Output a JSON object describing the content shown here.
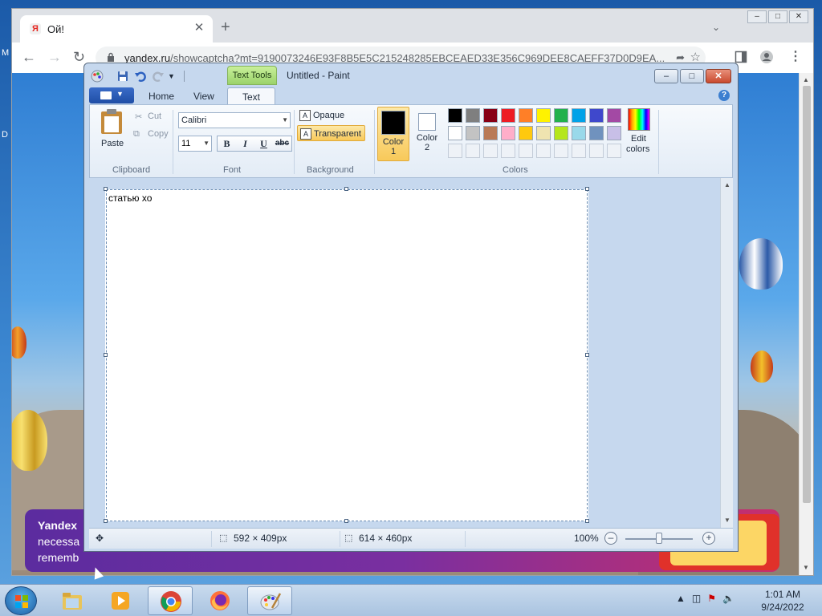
{
  "desktop": {
    "edge_labels": [
      "M",
      "D"
    ]
  },
  "browser": {
    "tab_title": "Ой!",
    "favicon_letter": "Я",
    "tab_close": "✕",
    "new_tab": "+",
    "url_domain": "yandex.ru",
    "url_rest": "/showcaptcha?mt=9190073246E93F8B5E5C215248285EBCEAED33E356C969DEE8CAEFF37D0D9EA...",
    "cookie_title": "Yandex",
    "cookie_line1": "necessa",
    "cookie_line2": "rememb"
  },
  "paint": {
    "context_tab": "Text Tools",
    "title": "Untitled - Paint",
    "tabs": [
      "Home",
      "View",
      "Text"
    ],
    "active_tab": "Text",
    "clipboard": {
      "paste": "Paste",
      "cut": "Cut",
      "copy": "Copy",
      "group": "Clipboard"
    },
    "font": {
      "family": "Calibri",
      "size": "11",
      "group": "Font",
      "bold": "B",
      "italic": "I",
      "underline": "U",
      "strike": "abc"
    },
    "background": {
      "opaque": "Opaque",
      "transparent": "Transparent",
      "group": "Background"
    },
    "colors": {
      "color1_label": "Color",
      "color1_num": "1",
      "color2_label": "Color",
      "color2_num": "2",
      "edit_label": "Edit",
      "edit_label2": "colors",
      "group": "Colors",
      "color1": "#000000",
      "color2": "#ffffff",
      "palette_row1": [
        "#000000",
        "#7f7f7f",
        "#880015",
        "#ed1c24",
        "#ff7f27",
        "#fff200",
        "#22b14c",
        "#00a2e8",
        "#3f48cc",
        "#a349a4"
      ],
      "palette_row2": [
        "#ffffff",
        "#c3c3c3",
        "#b97a57",
        "#ffaec9",
        "#ffc90e",
        "#efe4b0",
        "#b5e61d",
        "#99d9ea",
        "#7092be",
        "#c8bfe7"
      ]
    },
    "canvas_text": "статью хо",
    "status": {
      "selection_size": "592 × 409px",
      "image_size": "614 × 460px",
      "zoom": "100%"
    }
  },
  "taskbar": {
    "time": "1:01 AM",
    "date": "9/24/2022"
  }
}
